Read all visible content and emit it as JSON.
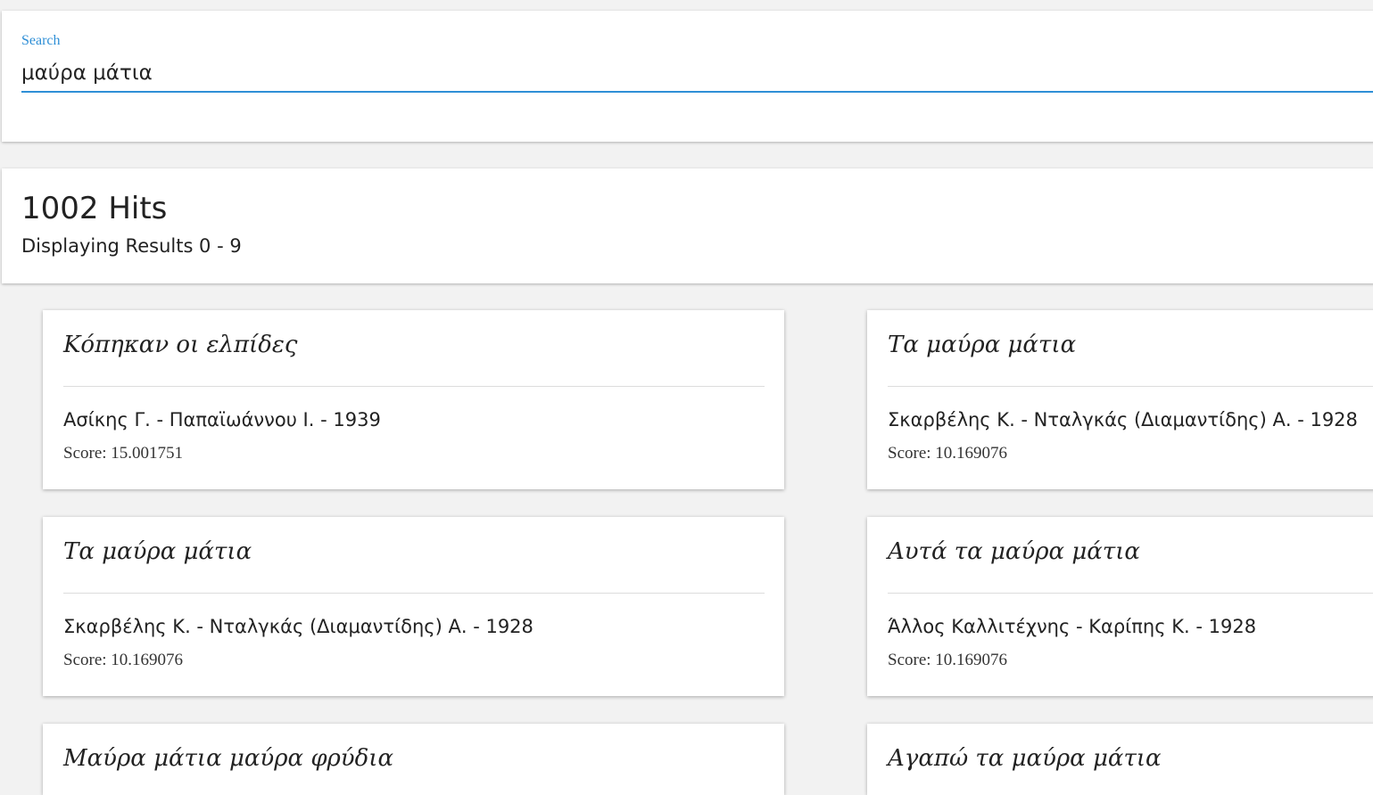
{
  "search": {
    "label": "Search",
    "value": "μαύρα μάτια"
  },
  "results_summary": {
    "hits": "1002 Hits",
    "range": "Displaying Results 0 - 9"
  },
  "results": [
    {
      "title": "Κόπηκαν οι ελπίδες",
      "artist": "Ασίκης Γ. - Παπαϊωάννου Ι. - 1939",
      "score": "Score: 15.001751"
    },
    {
      "title": "Τα μαύρα μάτια",
      "artist": "Σκαρβέλης Κ. - Νταλγκάς (Διαμαντίδης) Α. - 1928",
      "score": "Score: 10.169076"
    },
    {
      "title": "Τα μαύρα μάτια",
      "artist": "Σκαρβέλης Κ. - Νταλγκάς (Διαμαντίδης) Α. - 1928",
      "score": "Score: 10.169076"
    },
    {
      "title": "Αυτά τα μαύρα μάτια",
      "artist": "Άλλος Καλλιτέχνης - Καρίπης Κ. - 1928",
      "score": "Score: 10.169076"
    },
    {
      "title": "Μαύρα μάτια μαύρα φρύδια",
      "artist": "",
      "score": ""
    },
    {
      "title": "Αγαπώ τα μαύρα μάτια",
      "artist": "",
      "score": ""
    }
  ]
}
